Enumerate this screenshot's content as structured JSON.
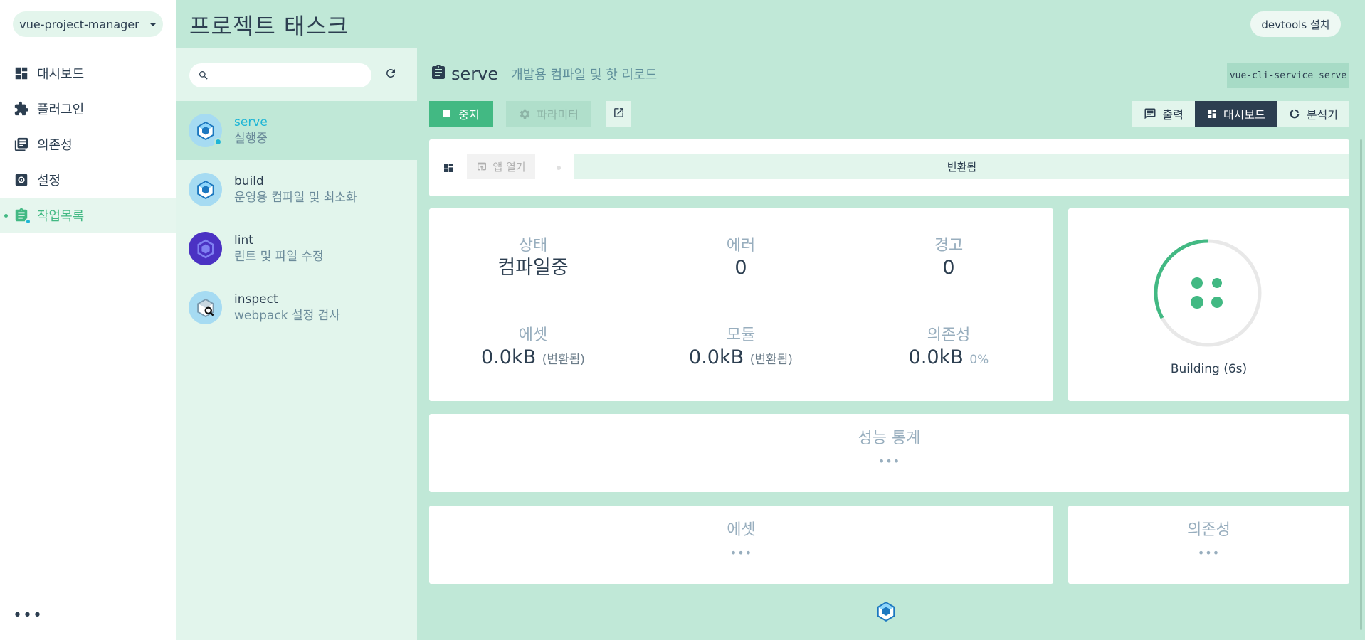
{
  "colors": {
    "accent": "#42b983",
    "primary_dark": "#2c3e50",
    "mint": "#c0e8d7",
    "light_mint": "#e2f5ec",
    "running": "#1eb5d6"
  },
  "nav": {
    "project": "vue-project-manager",
    "items": [
      {
        "label": "대시보드",
        "icon": "dashboard-icon"
      },
      {
        "label": "플러그인",
        "icon": "puzzle-icon"
      },
      {
        "label": "의존성",
        "icon": "library-icon"
      },
      {
        "label": "설정",
        "icon": "gear-icon"
      },
      {
        "label": "작업목록",
        "icon": "clipboard-icon",
        "active": true
      }
    ],
    "more": "•••"
  },
  "header": {
    "title": "프로젝트 태스크",
    "devtools": "devtools 설치"
  },
  "search": {
    "placeholder": ""
  },
  "tasks": [
    {
      "name": "serve",
      "description": "실행중",
      "icon": "webpack-icon",
      "active": true
    },
    {
      "name": "build",
      "description": "운영용 컴파일 및 최소화",
      "icon": "webpack-icon"
    },
    {
      "name": "lint",
      "description": "린트 및 파일 수정",
      "icon": "eslint-icon"
    },
    {
      "name": "inspect",
      "description": "webpack 설정 검사",
      "icon": "webpack-inspect-icon"
    }
  ],
  "task_detail": {
    "name": "serve",
    "subtitle": "개발용 컴파일 및 핫 리로드",
    "command": "vue-cli-service serve",
    "stop": "중지",
    "parameters": "파라미터",
    "view_tabs": [
      {
        "label": "출력",
        "icon": "console-icon"
      },
      {
        "label": "대시보드",
        "icon": "dashboard-icon",
        "active": true
      },
      {
        "label": "분석기",
        "icon": "donut-icon"
      }
    ]
  },
  "dashboard": {
    "open_app": "앱 열기",
    "progress_label": "변환됨",
    "stats": {
      "status": {
        "label": "상태",
        "value": "컴파일중"
      },
      "errors": {
        "label": "에러",
        "value": "0"
      },
      "warnings": {
        "label": "경고",
        "value": "0"
      },
      "assets": {
        "label": "에셋",
        "value": "0.0kB",
        "unit": "(변환됨)"
      },
      "modules": {
        "label": "모듈",
        "value": "0.0kB",
        "unit": "(변환됨)"
      },
      "dependencies": {
        "label": "의존성",
        "value": "0.0kB",
        "unit": "0%"
      }
    },
    "build": {
      "label": "Building (6s)",
      "progress": 0.33
    },
    "perf": {
      "title": "성능 통계",
      "dots": "•••"
    },
    "assets_section": {
      "title": "에셋",
      "dots": "•••"
    },
    "deps_section": {
      "title": "의존성",
      "dots": "•••"
    }
  }
}
